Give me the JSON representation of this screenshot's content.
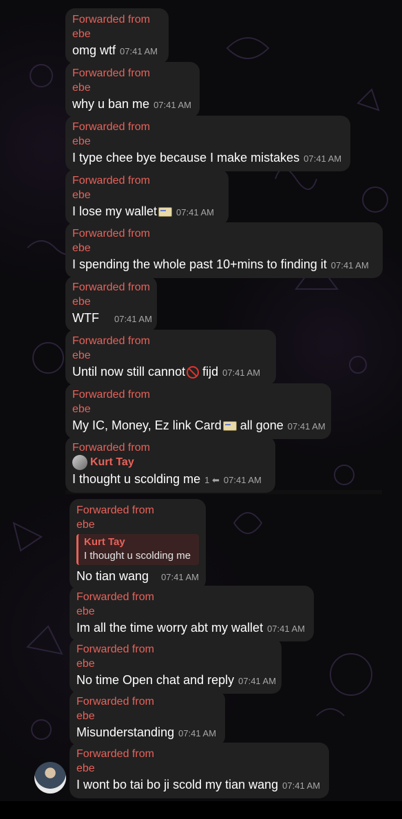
{
  "messages": [
    {
      "fwd_label": "Forwarded from",
      "fwd_name": "ebe",
      "text": "omg wtf",
      "time": "07:41 AM"
    },
    {
      "fwd_label": "Forwarded from",
      "fwd_name": "ebe",
      "text": "why u ban me",
      "time": "07:41 AM"
    },
    {
      "fwd_label": "Forwarded from",
      "fwd_name": "ebe",
      "text": "I type chee bye because I make mistakes",
      "time": "07:41 AM"
    },
    {
      "fwd_label": "Forwarded from",
      "fwd_name": "ebe",
      "text": "I lose my wallet",
      "emoji": "credit-card-icon",
      "time": "07:41 AM"
    },
    {
      "fwd_label": "Forwarded from",
      "fwd_name": "ebe",
      "text": "I spending the whole past 10+mins to finding it",
      "time": "07:41 AM"
    },
    {
      "fwd_label": "Forwarded from",
      "fwd_name": "ebe",
      "text": "WTF",
      "time": "07:41 AM"
    },
    {
      "fwd_label": "Forwarded from",
      "fwd_name": "ebe",
      "text": "Until now still cannot",
      "emoji": "no-entry-icon",
      "text2": " fijd",
      "time": "07:41 AM"
    },
    {
      "fwd_label": "Forwarded from",
      "fwd_name": "ebe",
      "text": "My IC, Money, Ez link Card",
      "emoji": "credit-card-icon",
      "text2": " all gone",
      "time": "07:41 AM"
    },
    {
      "fwd_label": "Forwarded from",
      "author": "Kurt Tay",
      "text": "I thought u scolding me",
      "reply_count": "1",
      "time": "07:41 AM"
    }
  ],
  "messages2": [
    {
      "fwd_label": "Forwarded from",
      "fwd_name": "ebe",
      "quote_name": "Kurt Tay",
      "quote_text": "I thought u scolding me",
      "text": "No tian wang",
      "time": "07:41 AM"
    },
    {
      "fwd_label": "Forwarded from",
      "fwd_name": "ebe",
      "text": "Im all the time worry abt my wallet",
      "time": "07:41 AM"
    },
    {
      "fwd_label": "Forwarded from",
      "fwd_name": "ebe",
      "text": "No time Open chat and reply",
      "time": "07:41 AM"
    },
    {
      "fwd_label": "Forwarded from",
      "fwd_name": "ebe",
      "text": "Misunderstanding",
      "time": "07:41 AM"
    },
    {
      "fwd_label": "Forwarded from",
      "fwd_name": "ebe",
      "text": "I wont bo tai bo ji scold my tian wang",
      "time": "07:41 AM"
    }
  ],
  "colors": {
    "accent": "#e8625a",
    "bubble": "#212121",
    "background": "#0b0a0d"
  }
}
